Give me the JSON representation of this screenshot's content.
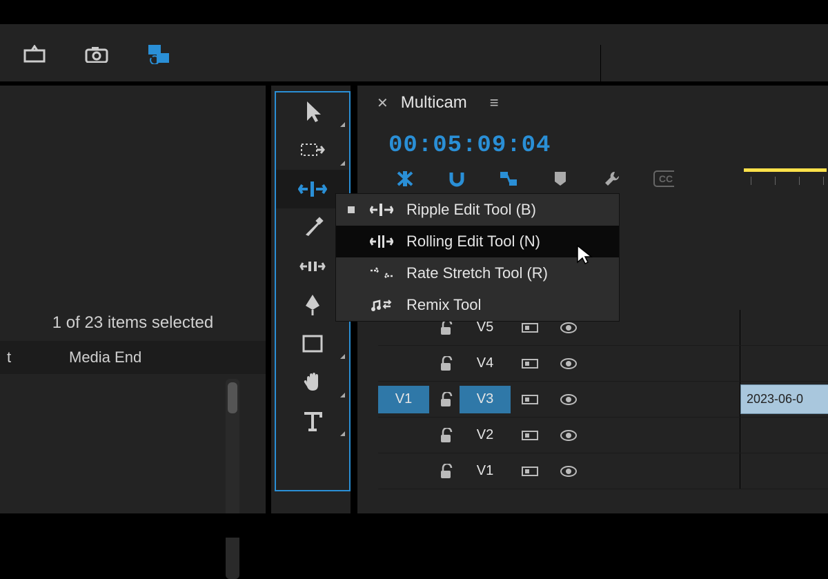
{
  "topbar": {
    "plus_label": "+"
  },
  "project": {
    "selection_text": "1 of 23 items selected",
    "col_start": "t",
    "col_media_end": "Media End"
  },
  "tools": {
    "items": [
      "selection",
      "track-select",
      "ripple-edit",
      "razor",
      "slip",
      "pen",
      "rectangle",
      "hand",
      "type"
    ],
    "active_index": 2
  },
  "flyout": {
    "items": [
      {
        "icon": "ripple-icon",
        "label": "Ripple Edit Tool (B)",
        "checked": true,
        "hover": false
      },
      {
        "icon": "rolling-icon",
        "label": "Rolling Edit Tool (N)",
        "checked": false,
        "hover": true
      },
      {
        "icon": "rate-icon",
        "label": "Rate Stretch Tool (R)",
        "checked": false,
        "hover": false
      },
      {
        "icon": "remix-icon",
        "label": "Remix Tool",
        "checked": false,
        "hover": false
      }
    ]
  },
  "timeline": {
    "tab_title": "Multicam",
    "timecode": "00:05:09:04",
    "icons": [
      "nest",
      "snap",
      "linked",
      "marker",
      "wrench",
      "cc"
    ],
    "tracks": [
      {
        "src": "",
        "tgt": "V5",
        "src_on": false,
        "tgt_on": false
      },
      {
        "src": "",
        "tgt": "V4",
        "src_on": false,
        "tgt_on": false
      },
      {
        "src": "V1",
        "tgt": "V3",
        "src_on": true,
        "tgt_on": true,
        "clip": "2023-06-0"
      },
      {
        "src": "",
        "tgt": "V2",
        "src_on": false,
        "tgt_on": false
      },
      {
        "src": "",
        "tgt": "V1",
        "src_on": false,
        "tgt_on": false
      }
    ]
  }
}
